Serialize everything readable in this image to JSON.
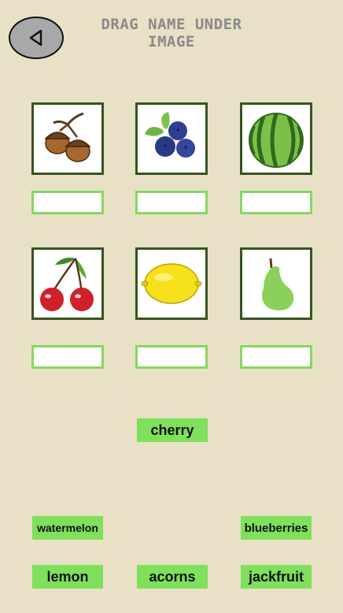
{
  "title": "DRAG NAME UNDER IMAGE",
  "icons": {
    "back": "back-triangle-icon",
    "images": [
      "acorns-icon",
      "blueberries-icon",
      "watermelon-icon",
      "cherry-icon",
      "lemon-icon",
      "pear-icon"
    ]
  },
  "colors": {
    "background": "#e8e1c5",
    "tile_border": "#375421",
    "slot_border": "#86d860",
    "chip_fill": "#7fe05b",
    "title_text": "#8a8a8a"
  },
  "name_chips": {
    "cherry": "cherry",
    "watermelon": "watermelon",
    "blueberries": "blueberries",
    "lemon": "lemon",
    "acorns": "acorns",
    "jackfruit": "jackfruit"
  }
}
